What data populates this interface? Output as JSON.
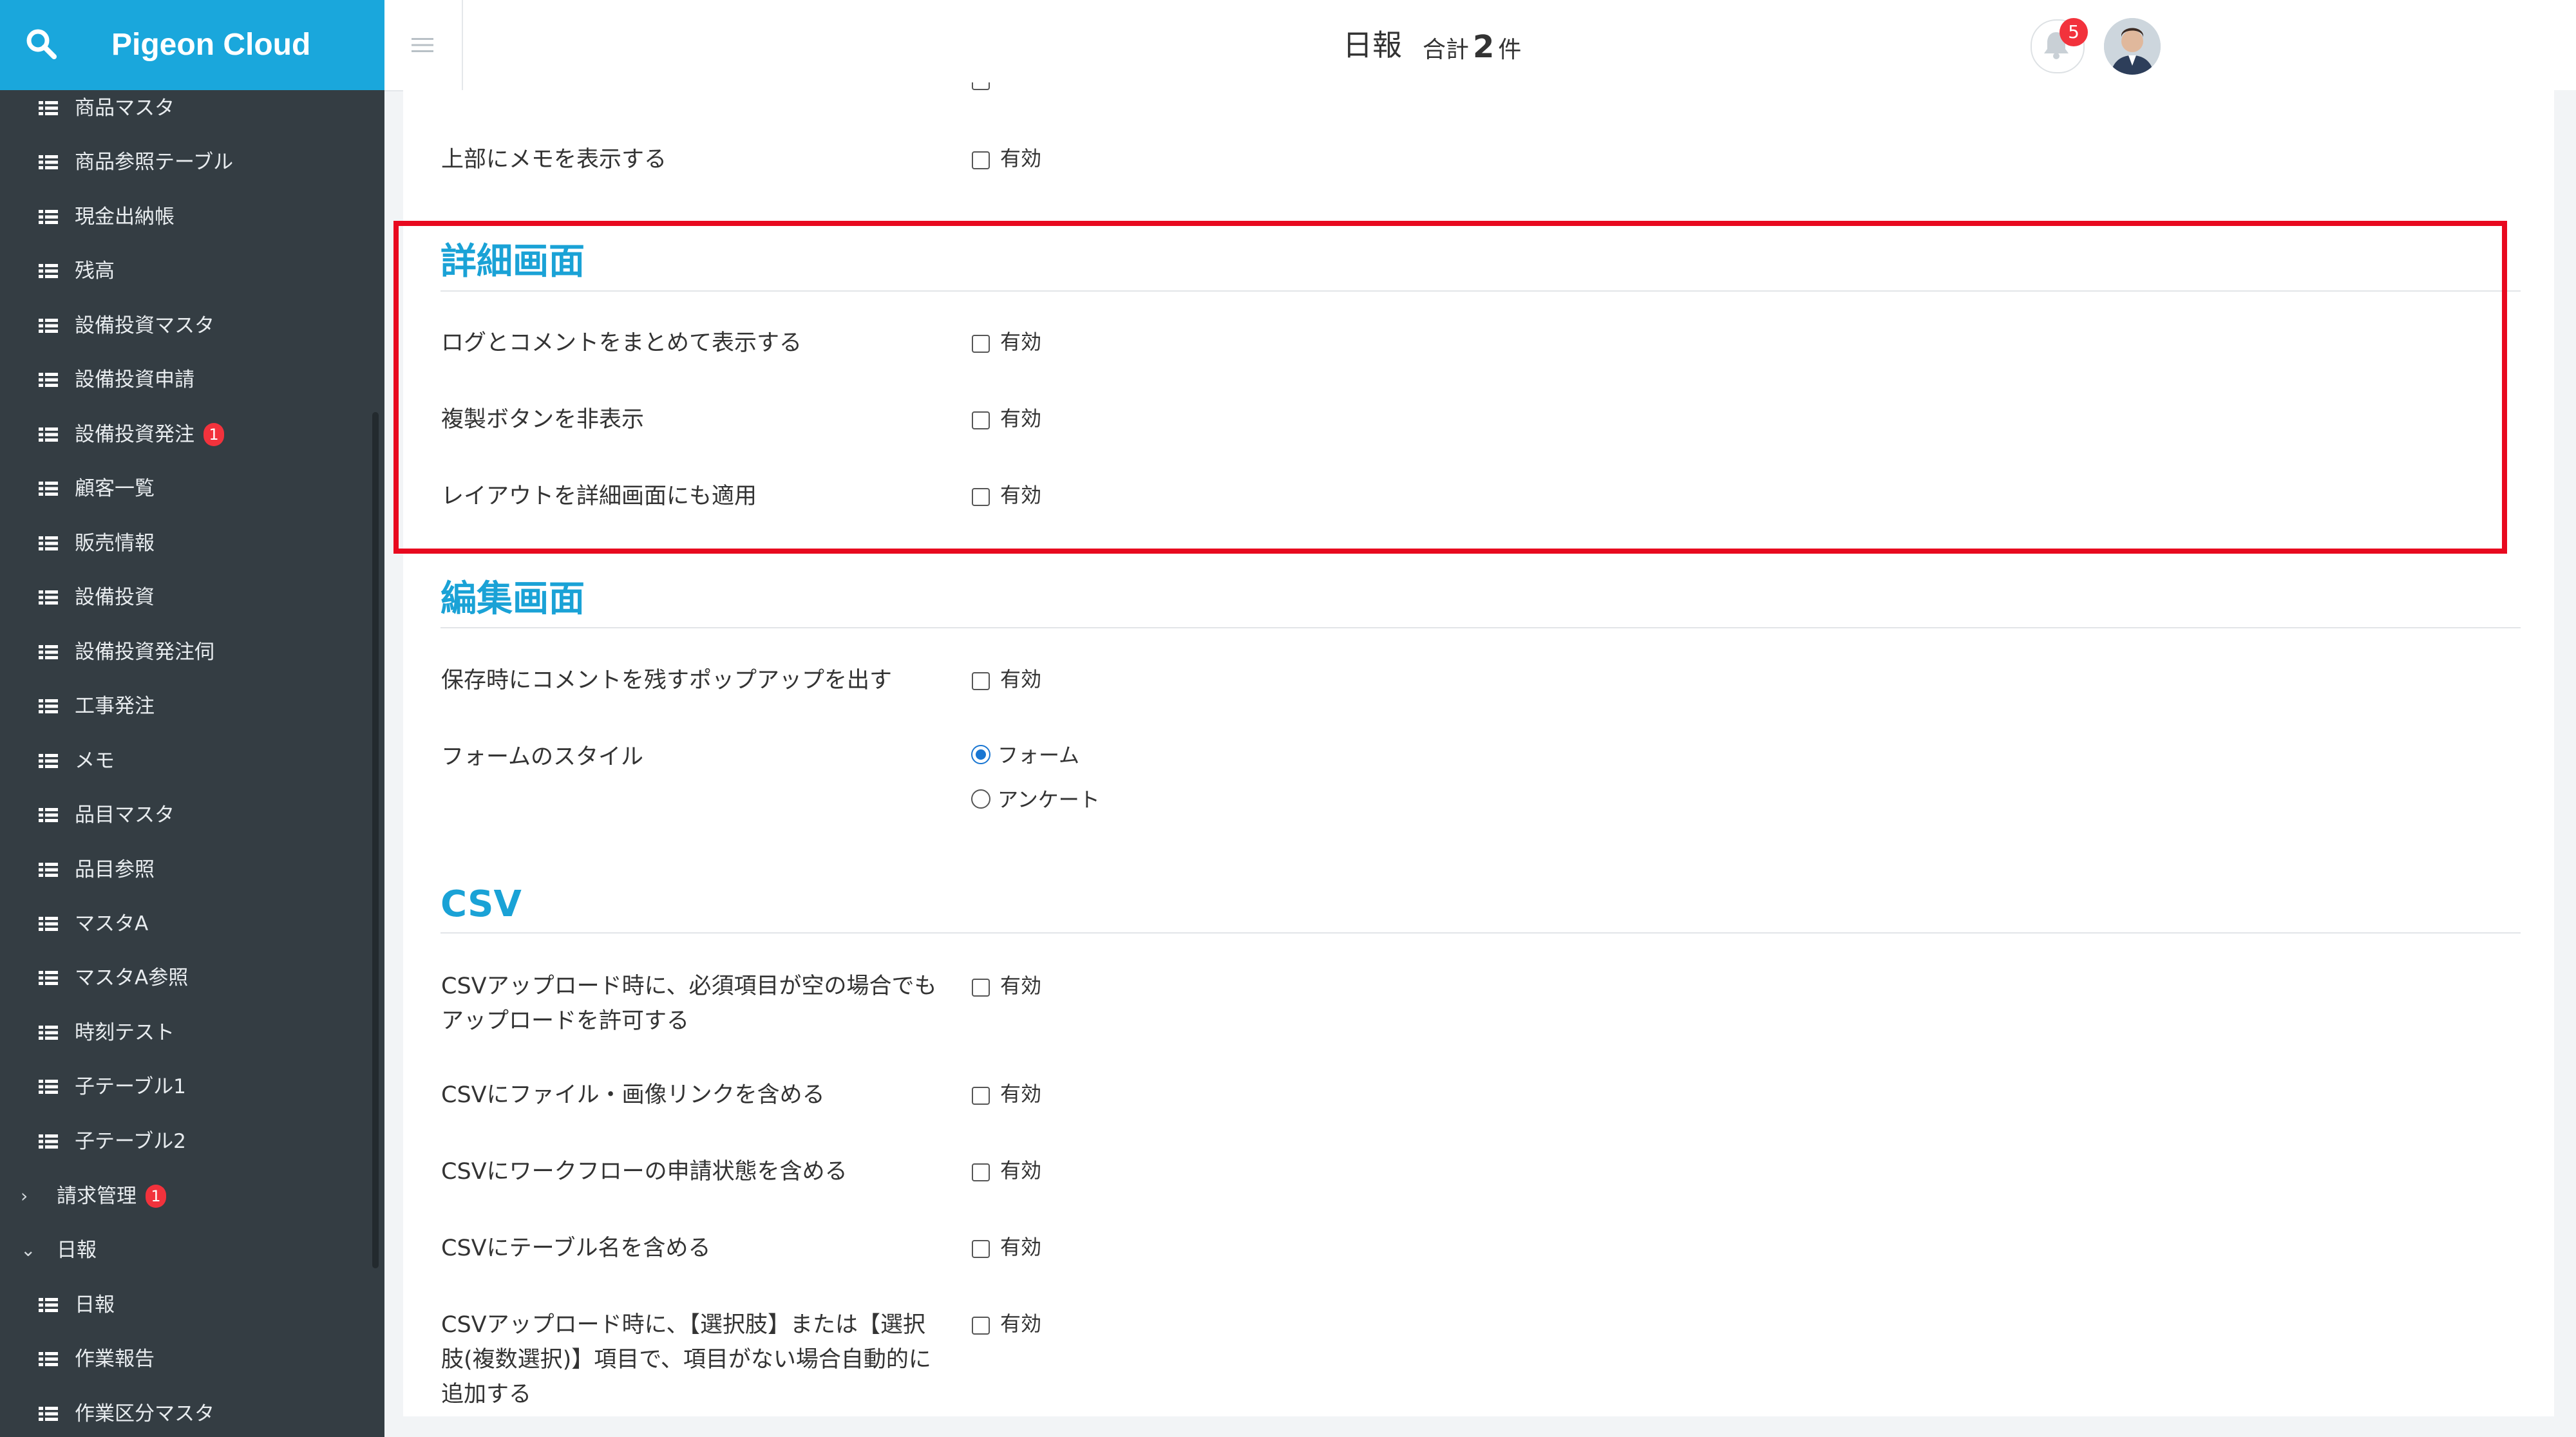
{
  "brand": {
    "title": "Pigeon Cloud"
  },
  "sidebar": {
    "items": [
      {
        "label": "商品マスタ"
      },
      {
        "label": "商品参照テーブル"
      },
      {
        "label": "現金出納帳"
      },
      {
        "label": "残高"
      },
      {
        "label": "設備投資マスタ"
      },
      {
        "label": "設備投資申請"
      },
      {
        "label": "設備投資発注",
        "badge": "1"
      },
      {
        "label": "顧客一覧"
      },
      {
        "label": "販売情報"
      },
      {
        "label": "設備投資"
      },
      {
        "label": "設備投資発注伺"
      },
      {
        "label": "工事発注"
      },
      {
        "label": "メモ"
      },
      {
        "label": "品目マスタ"
      },
      {
        "label": "品目参照"
      },
      {
        "label": "マスタA"
      },
      {
        "label": "マスタA参照"
      },
      {
        "label": "時刻テスト"
      },
      {
        "label": "子テーブル1"
      },
      {
        "label": "子テーブル2"
      }
    ],
    "groups": [
      {
        "label": "請求管理",
        "badge": "1",
        "chevron": "›"
      },
      {
        "label": "日報",
        "chevron": "⌄"
      }
    ],
    "sub_items": [
      {
        "label": "日報"
      },
      {
        "label": "作業報告"
      },
      {
        "label": "作業区分マスタ"
      }
    ]
  },
  "header": {
    "title": "日報",
    "total_prefix": "合計",
    "total_count": "2",
    "total_suffix": "件",
    "notification_count": "5"
  },
  "settings": {
    "top_memo": {
      "label": "上部にメモを表示する",
      "option": "有効"
    },
    "detail": {
      "title": "詳細画面",
      "rows": [
        {
          "label": "ログとコメントをまとめて表示する",
          "option": "有効"
        },
        {
          "label": "複製ボタンを非表示",
          "option": "有効"
        },
        {
          "label": "レイアウトを詳細画面にも適用",
          "option": "有効"
        }
      ]
    },
    "edit": {
      "title": "編集画面",
      "popup": {
        "label": "保存時にコメントを残すポップアップを出す",
        "option": "有効"
      },
      "form_style": {
        "label": "フォームのスタイル",
        "options": [
          "フォーム",
          "アンケート"
        ],
        "selected": "フォーム"
      }
    },
    "csv": {
      "title": "CSV",
      "rows": [
        {
          "label_lines": [
            "CSVアップロード時に、必須項目が空の場合でも",
            "アップロードを許可する"
          ],
          "option": "有効"
        },
        {
          "label_lines": [
            "CSVにファイル・画像リンクを含める"
          ],
          "option": "有効"
        },
        {
          "label_lines": [
            "CSVにワークフローの申請状態を含める"
          ],
          "option": "有効"
        },
        {
          "label_lines": [
            "CSVにテーブル名を含める"
          ],
          "option": "有効"
        },
        {
          "label_lines": [
            "CSVアップロード時に、【選択肢】または【選択",
            "肢(複数選択)】項目で、項目がない場合自動的に",
            "追加する"
          ],
          "option": "有効"
        }
      ]
    }
  },
  "colors": {
    "brand": "#1aa7dc",
    "sidebar": "#343d43",
    "section_title": "#1aa2d6",
    "highlight": "#e8091f",
    "badge": "#f2323c"
  }
}
